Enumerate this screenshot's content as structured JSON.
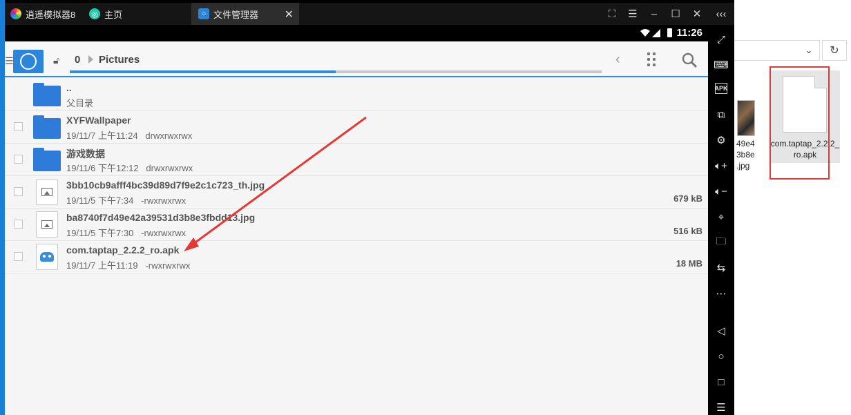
{
  "window": {
    "app_tab": "逍遥模拟器8",
    "home_tab": "主页",
    "fm_tab": "文件管理器",
    "controls": [
      "⛶",
      "☰",
      "–",
      "☐",
      "✕"
    ],
    "collapse": "‹‹‹"
  },
  "status": {
    "time": "11:26"
  },
  "file_manager": {
    "breadcrumb": [
      "0",
      "Pictures"
    ],
    "progress_fraction": 0.5
  },
  "files": [
    {
      "type": "parent",
      "name": "..",
      "meta": "父目录",
      "size": ""
    },
    {
      "type": "folder",
      "name": "XYFWallpaper",
      "meta": "19/11/7 上午11:24   drwxrwxrwx",
      "size": ""
    },
    {
      "type": "folder",
      "name": "游戏数据",
      "meta": "19/11/6 下午12:12   drwxrwxrwx",
      "size": ""
    },
    {
      "type": "image",
      "name": "3bb10cb9afff4bc39d89d7f9e2c1c723_th.jpg",
      "meta": "19/11/5 下午7:34   -rwxrwxrwx",
      "size": "679 kB"
    },
    {
      "type": "image",
      "name": "ba8740f7d49e42a39531d3b8e3fbdd13.jpg",
      "meta": "19/11/5 下午7:30   -rwxrwxrwx",
      "size": "516 kB"
    },
    {
      "type": "apk",
      "name": "com.taptap_2.2.2_ro.apk",
      "meta": "19/11/7 上午11:19   -rwxrwxrwx",
      "size": "18 MB"
    }
  ],
  "explorer": {
    "partial_name": "49e4\n3b8e\n.jpg",
    "file_name": "com.taptap_2.2.2_ro.apk"
  },
  "sidebar_icons": [
    "fullscreen-icon",
    "keyboard-icon",
    "apk-icon",
    "multi-window-icon",
    "settings-icon",
    "volume-up-icon",
    "volume-down-icon",
    "location-icon",
    "folder-icon",
    "rotate-icon",
    "more-icon",
    "back-icon",
    "home-icon",
    "recents-icon",
    "menu-icon"
  ],
  "colors": {
    "accent": "#2d8ee0",
    "folder": "#2f7bd9",
    "annotation": "#e53935"
  }
}
